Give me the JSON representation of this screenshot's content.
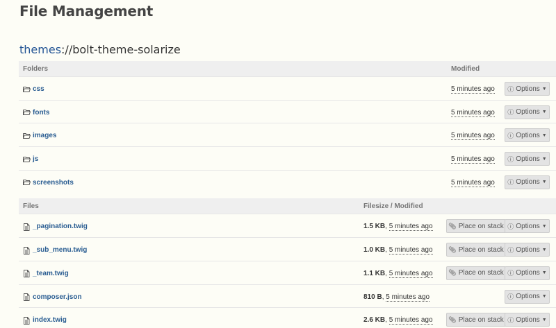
{
  "page_title": "File Management",
  "path": {
    "namespace": "themes",
    "separator": "://",
    "folder": "bolt-theme-solarize"
  },
  "folders_header": {
    "name": "Folders",
    "modified": "Modified"
  },
  "folders": [
    {
      "name": "css",
      "modified": "5 minutes ago",
      "options_label": "Options"
    },
    {
      "name": "fonts",
      "modified": "5 minutes ago",
      "options_label": "Options"
    },
    {
      "name": "images",
      "modified": "5 minutes ago",
      "options_label": "Options"
    },
    {
      "name": "js",
      "modified": "5 minutes ago",
      "options_label": "Options"
    },
    {
      "name": "screenshots",
      "modified": "5 minutes ago",
      "options_label": "Options"
    }
  ],
  "files_header": {
    "name": "Files",
    "size_modified": "Filesize / Modified"
  },
  "files": [
    {
      "name": "_pagination.twig",
      "size": "1.5 KB",
      "modified": "5 minutes ago",
      "place_label": "Place on stack",
      "options_label": "Options"
    },
    {
      "name": "_sub_menu.twig",
      "size": "1.0 KB",
      "modified": "5 minutes ago",
      "place_label": "Place on stack",
      "options_label": "Options"
    },
    {
      "name": "_team.twig",
      "size": "1.1 KB",
      "modified": "5 minutes ago",
      "place_label": "Place on stack",
      "options_label": "Options"
    },
    {
      "name": "composer.json",
      "size": "810 B",
      "modified": "5 minutes ago",
      "place_label": "",
      "options_label": "Options"
    },
    {
      "name": "index.twig",
      "size": "2.6 KB",
      "modified": "5 minutes ago",
      "place_label": "Place on stack",
      "options_label": "Options"
    }
  ],
  "icons": {
    "folder": "folder-open-icon",
    "file": "file-icon",
    "info": "info-circle-icon",
    "paperclip": "paperclip-icon",
    "caret": "caret-down-icon"
  }
}
